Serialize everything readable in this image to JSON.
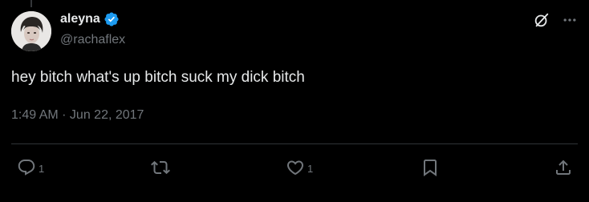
{
  "tweet": {
    "author": {
      "display_name": "aleyna",
      "handle": "@rachaflex",
      "verified": true,
      "verified_color": "#1d9bf0"
    },
    "text": "hey bitch what's up bitch suck my dick bitch",
    "timestamp": "1:49 AM · Jun 22, 2017",
    "top_icons": [
      "grok-icon",
      "more-icon"
    ],
    "actions": {
      "reply": {
        "icon": "reply-icon",
        "count": "1"
      },
      "repost": {
        "icon": "repost-icon",
        "count": ""
      },
      "like": {
        "icon": "like-icon",
        "count": "1"
      },
      "bookmark": {
        "icon": "bookmark-icon",
        "count": ""
      },
      "share": {
        "icon": "share-icon",
        "count": ""
      }
    }
  },
  "theme": {
    "background": "#000000",
    "text": "#e7e9ea",
    "muted": "#71767b",
    "divider": "#2f3336"
  }
}
